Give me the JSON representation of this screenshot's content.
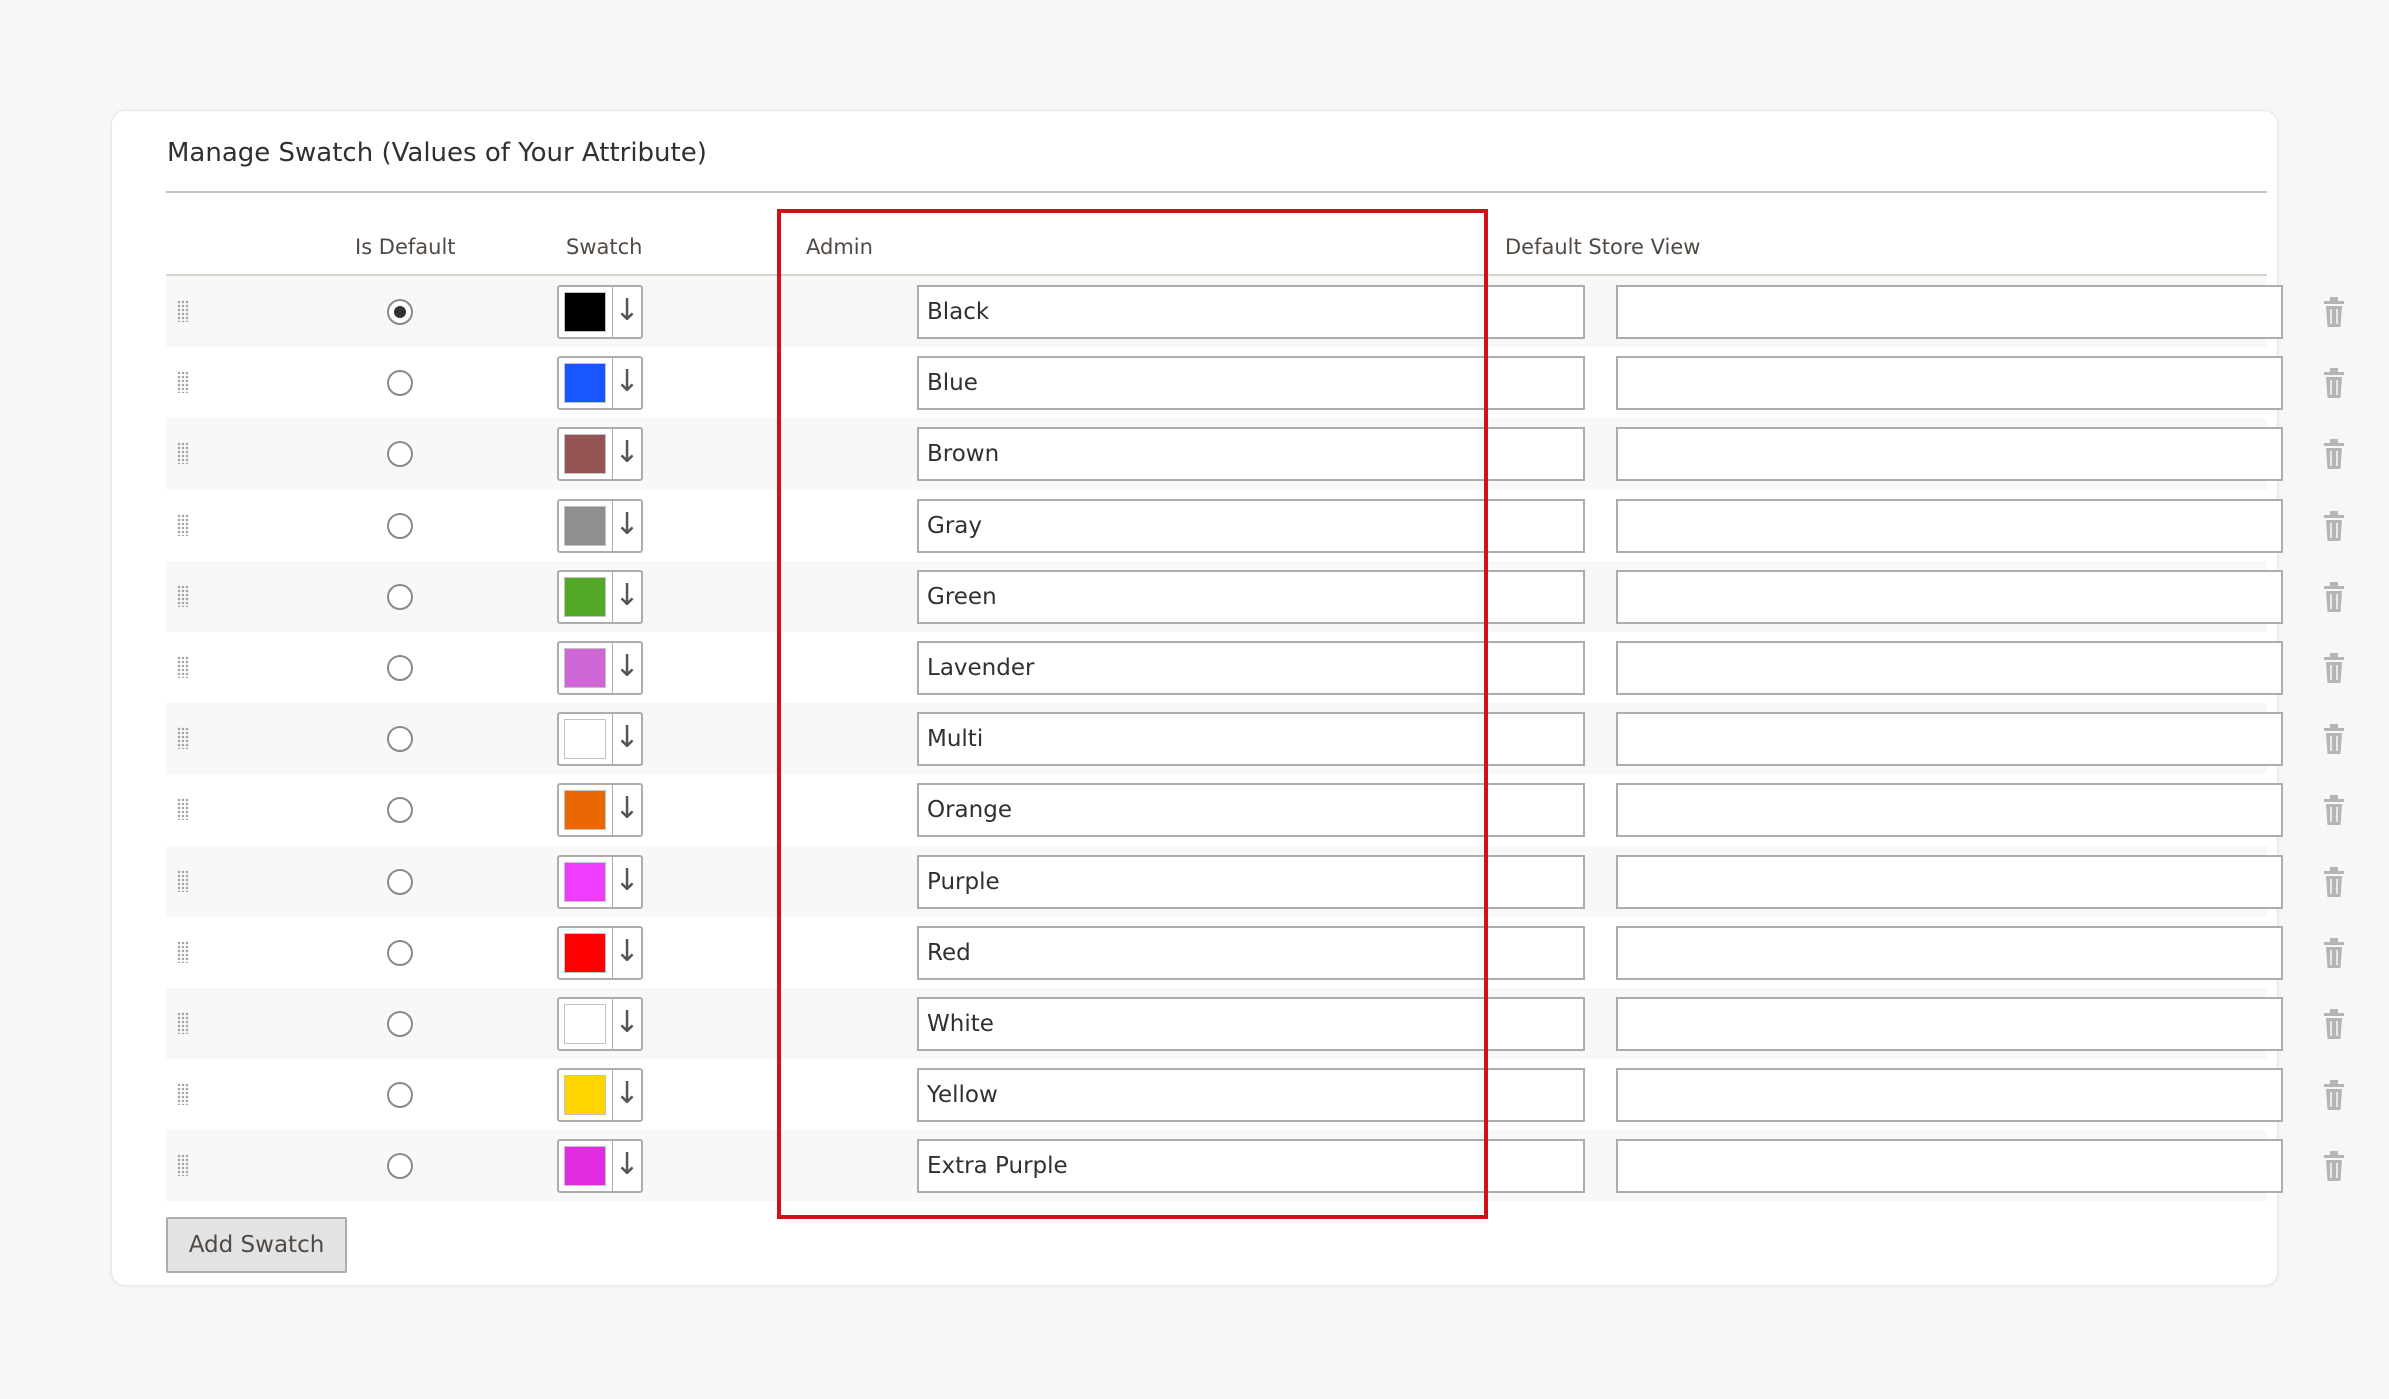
{
  "panel": {
    "title": "Manage Swatch (Values of Your Attribute)"
  },
  "columns": {
    "is_default": "Is Default",
    "swatch": "Swatch",
    "admin": "Admin",
    "store_view": "Default Store View"
  },
  "rows": [
    {
      "admin": "Black",
      "color": "#000000",
      "is_default": true,
      "store_view": ""
    },
    {
      "admin": "Blue",
      "color": "#1a56ff",
      "is_default": false,
      "store_view": ""
    },
    {
      "admin": "Brown",
      "color": "#945454",
      "is_default": false,
      "store_view": ""
    },
    {
      "admin": "Gray",
      "color": "#8f8f8f",
      "is_default": false,
      "store_view": ""
    },
    {
      "admin": "Green",
      "color": "#53a828",
      "is_default": false,
      "store_view": ""
    },
    {
      "admin": "Lavender",
      "color": "#ce66d6",
      "is_default": false,
      "store_view": ""
    },
    {
      "admin": "Multi",
      "color": "#ffffff",
      "is_default": false,
      "store_view": ""
    },
    {
      "admin": "Orange",
      "color": "#eb6703",
      "is_default": false,
      "store_view": ""
    },
    {
      "admin": "Purple",
      "color": "#ef3dff",
      "is_default": false,
      "store_view": ""
    },
    {
      "admin": "Red",
      "color": "#ff0000",
      "is_default": false,
      "store_view": ""
    },
    {
      "admin": "White",
      "color": "#ffffff",
      "is_default": false,
      "store_view": ""
    },
    {
      "admin": "Yellow",
      "color": "#ffd500",
      "is_default": false,
      "store_view": ""
    },
    {
      "admin": "Extra Purple",
      "color": "#e22ce2",
      "is_default": false,
      "store_view": ""
    }
  ],
  "icons": {
    "drag": "drag-handle-icon",
    "arrow": "arrow-down-icon",
    "delete": "trash-icon"
  },
  "highlight_color": "#d21019",
  "add_button": "Add Swatch"
}
